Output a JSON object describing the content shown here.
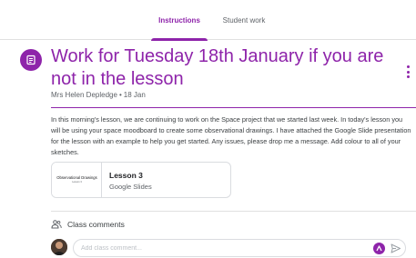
{
  "tabs": [
    {
      "label": "Instructions",
      "active": true
    },
    {
      "label": "Student work",
      "active": false
    }
  ],
  "assignment": {
    "title": "Work for Tuesday 18th January if you are not in the lesson",
    "author": "Mrs Helen Depledge",
    "separator": "•",
    "date": "18 Jan",
    "description": "In this morning's lesson, we are continuing to work on the Space project that we started last week.  In today's lesson you will be using your space moodboard to create some observational drawings.  I have attached the Google Slide presentation for the lesson with an example to help you get started.  Any issues, please drop me a message.  Add colour to all of your sketches.",
    "icon": "assignment-icon"
  },
  "attachment": {
    "thumbnail_title": "Observational Drawings",
    "thumbnail_subtitle": "Lesson 3",
    "title": "Lesson 3",
    "type": "Google Slides"
  },
  "comments": {
    "label": "Class comments",
    "placeholder": "Add class comment..."
  },
  "colors": {
    "accent": "#8e24aa",
    "text": "#3c4043",
    "muted": "#5f6368",
    "border": "#dadce0"
  }
}
